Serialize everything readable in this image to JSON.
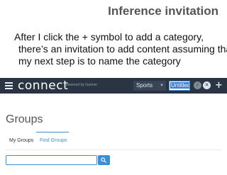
{
  "slide": {
    "title": "Inference invitation",
    "caption_lines": [
      "After I click the + symbol to add a category,",
      "there’s an invitation to add content assuming that",
      "my next step is to name the category"
    ]
  },
  "app": {
    "logo": "connect",
    "powered_by": "powered by Gartner",
    "category_select": "Sports",
    "name_input_value": "Untitled",
    "icons": {
      "menu": "hamburger-menu-icon",
      "confirm": "checkmark-icon",
      "cancel": "close-icon",
      "add": "plus-icon",
      "search": "search-icon",
      "dropdown": "chevron-down-icon"
    },
    "colors": {
      "header_bg": "#2a3442",
      "accent": "#3a8fd6",
      "selection": "#3a7bd5"
    }
  },
  "page": {
    "title": "Groups",
    "tabs": [
      {
        "label": "My Groups",
        "active": false
      },
      {
        "label": "Find Groups",
        "active": true
      }
    ],
    "search": {
      "value": "",
      "placeholder": ""
    }
  }
}
